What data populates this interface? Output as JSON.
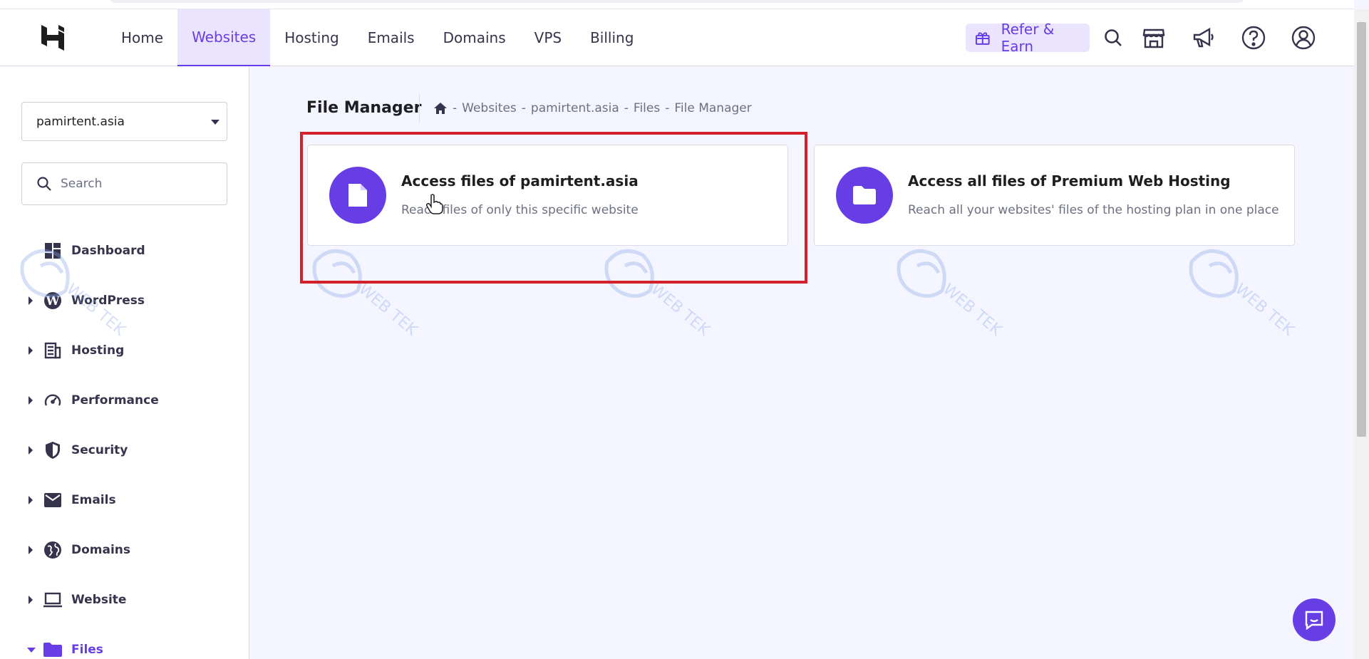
{
  "header": {
    "logo": "hostinger-logo-icon",
    "nav": [
      {
        "label": "Home",
        "active": false
      },
      {
        "label": "Websites",
        "active": true
      },
      {
        "label": "Hosting",
        "active": false
      },
      {
        "label": "Emails",
        "active": false
      },
      {
        "label": "Domains",
        "active": false
      },
      {
        "label": "VPS",
        "active": false
      },
      {
        "label": "Billing",
        "active": false
      }
    ],
    "refer_label": "Refer & Earn",
    "icons": [
      "search-icon",
      "store-icon",
      "megaphone-icon",
      "help-icon",
      "account-icon"
    ]
  },
  "sidebar": {
    "domain_select": "pamirtent.asia",
    "search_placeholder": "Search",
    "items": [
      {
        "label": "Dashboard",
        "icon": "dashboard-icon",
        "expandable": false
      },
      {
        "label": "WordPress",
        "icon": "wordpress-icon",
        "expandable": true
      },
      {
        "label": "Hosting",
        "icon": "hosting-icon",
        "expandable": true
      },
      {
        "label": "Performance",
        "icon": "performance-icon",
        "expandable": true
      },
      {
        "label": "Security",
        "icon": "shield-icon",
        "expandable": true
      },
      {
        "label": "Emails",
        "icon": "mail-icon",
        "expandable": true
      },
      {
        "label": "Domains",
        "icon": "globe-icon",
        "expandable": true
      },
      {
        "label": "Website",
        "icon": "laptop-icon",
        "expandable": true
      },
      {
        "label": "Files",
        "icon": "folder-icon",
        "expandable": true,
        "expanded": true
      }
    ]
  },
  "main": {
    "title": "File Manager",
    "breadcrumb": [
      "Websites",
      "pamirtent.asia",
      "Files",
      "File Manager"
    ],
    "breadcrumb_sep": "-",
    "cards": [
      {
        "title": "Access files of pamirtent.asia",
        "description": "Reach files of only this specific website",
        "icon": "file-icon"
      },
      {
        "title": "Access all files of Premium Web Hosting",
        "description": "Reach all your websites' files of the hosting plan in one place",
        "icon": "folder-icon"
      }
    ]
  },
  "watermark_text": "WEB TEK",
  "colors": {
    "accent": "#673de6",
    "accent_light": "#ebe4ff",
    "highlight": "#d4202c",
    "text": "#36344d",
    "muted": "#6d7081"
  }
}
